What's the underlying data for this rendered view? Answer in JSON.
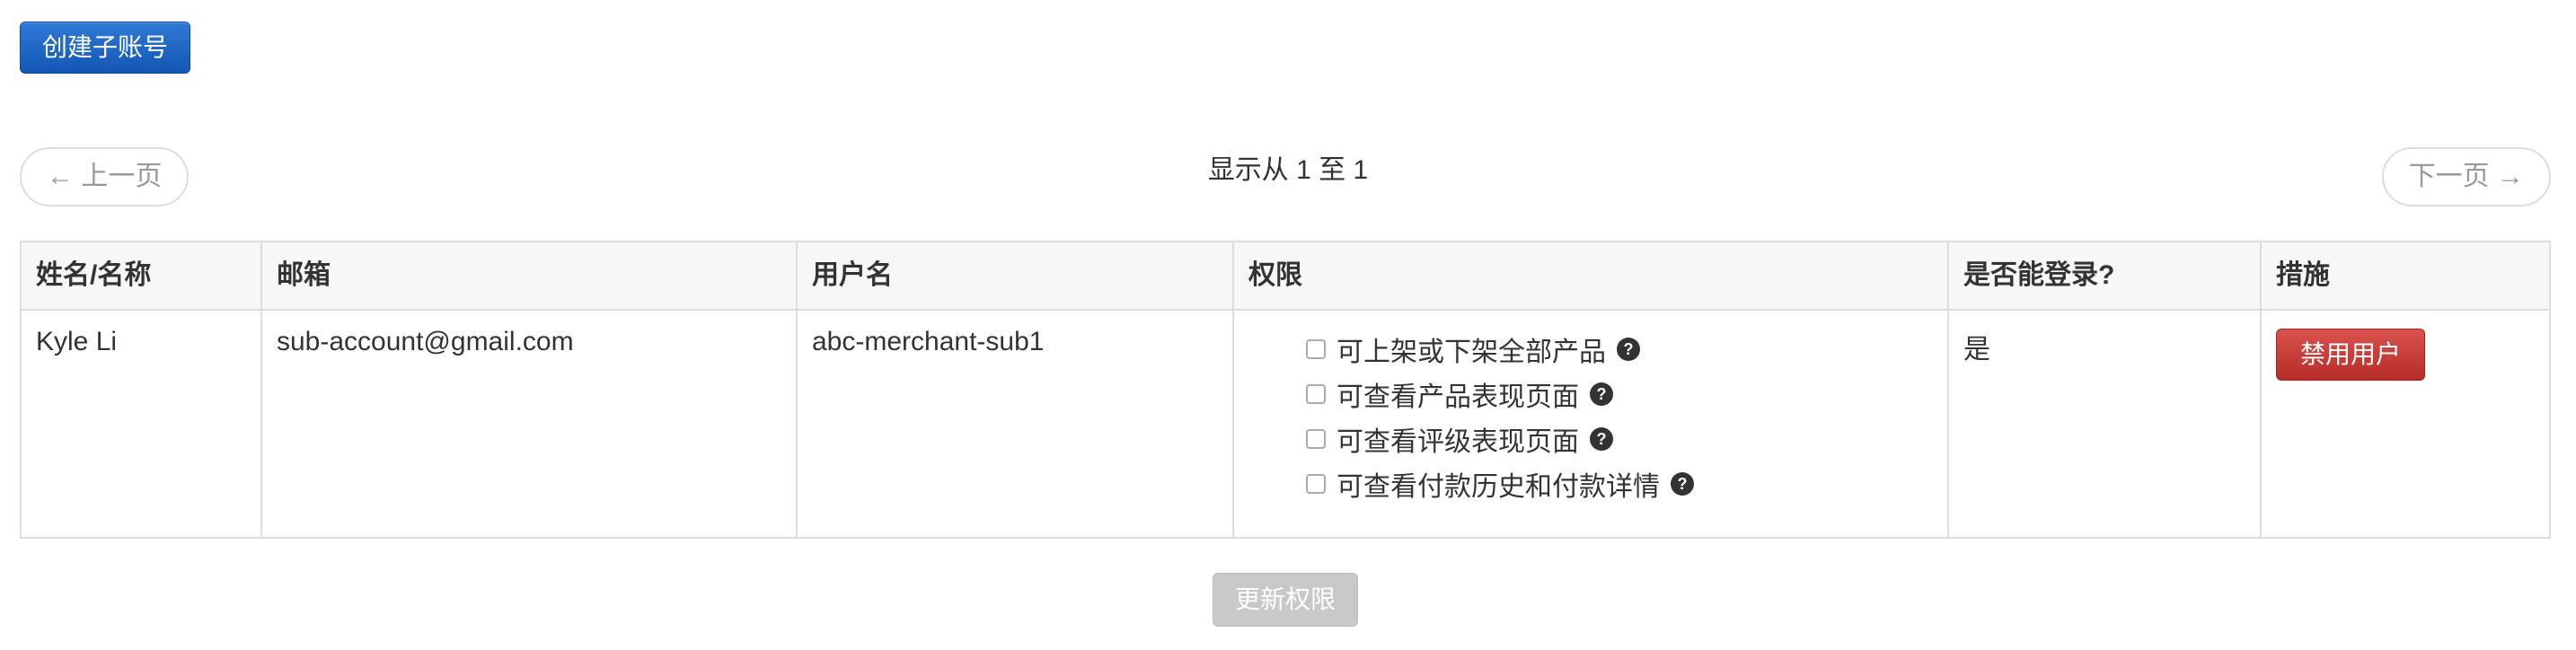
{
  "toolbar": {
    "create_label": "创建子账号"
  },
  "pager": {
    "prev_label": "← 上一页",
    "next_label": "下一页 →",
    "info": "显示从 1 至 1"
  },
  "table": {
    "headers": [
      "姓名/名称",
      "邮箱",
      "用户名",
      "权限",
      "是否能登录?",
      "措施"
    ],
    "rows": [
      {
        "name": "Kyle Li",
        "email": "sub-account@gmail.com",
        "username": "abc-merchant-sub1",
        "permissions": [
          {
            "label": "可上架或下架全部产品",
            "checked": false
          },
          {
            "label": "可查看产品表现页面",
            "checked": false
          },
          {
            "label": "可查看评级表现页面",
            "checked": false
          },
          {
            "label": "可查看付款历史和付款详情",
            "checked": false
          }
        ],
        "can_login": "是",
        "action_label": "禁用用户"
      }
    ]
  },
  "footer": {
    "update_label": "更新权限"
  },
  "icons": {
    "help": "question-circle-icon"
  },
  "colors": {
    "primary": "#1a5fc0",
    "danger": "#c9302c",
    "disabled": "#c8c8c8"
  }
}
